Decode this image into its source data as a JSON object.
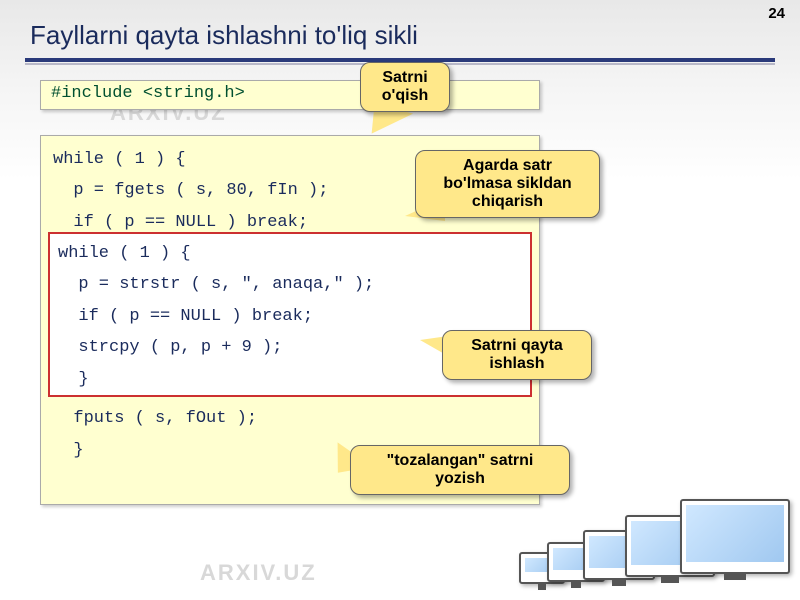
{
  "page_number": "24",
  "title": "Fayllarni qayta ishlashni to'liq sikli",
  "watermark": "ARXIV.UZ",
  "include_line": "#include <string.h>",
  "code": {
    "l1": "while ( 1 ) {",
    "l2": "  p = fgets ( s, 80, fIn );",
    "l3": "  if ( p == NULL ) break;",
    "l4": "  fputs ( s, fOut );",
    "l5": "  }"
  },
  "inner_code": {
    "l1": "while ( 1 ) {",
    "l2": "  p = strstr ( s, \", anaqa,\" );",
    "l3": "  if ( p == NULL ) break;",
    "l4": "  strcpy ( p, p + 9 );",
    "l5": "  }"
  },
  "callouts": {
    "c1": "Satrni o'qish",
    "c2": "Agarda satr bo'lmasa sikldan chiqarish",
    "c3": "Satrni qayta ishlash",
    "c4": "\"tozalangan\" satrni yozish"
  }
}
